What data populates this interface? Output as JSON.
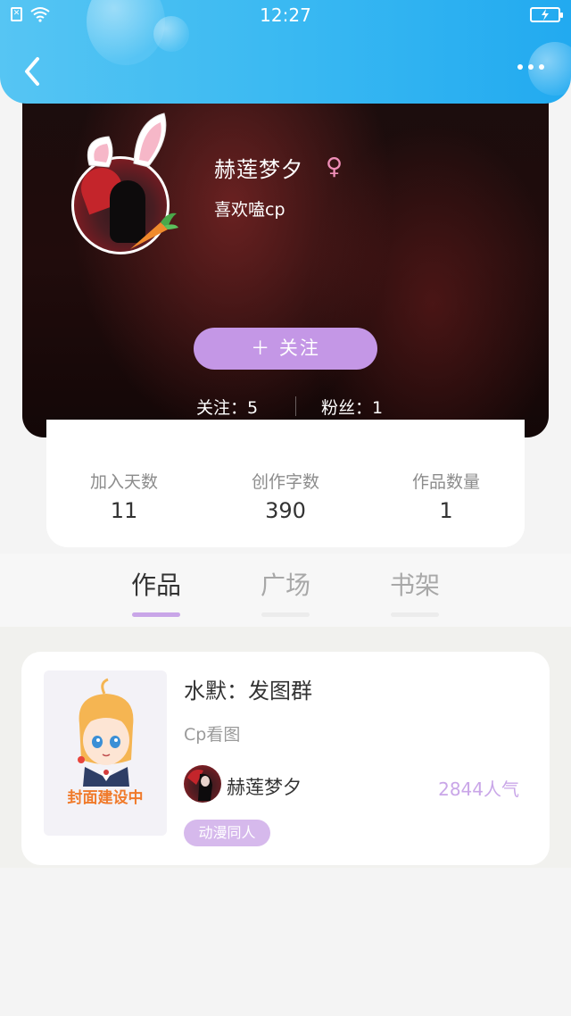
{
  "status_bar": {
    "time": "12:27"
  },
  "profile": {
    "username": "赫莲梦夕",
    "gender_symbol": "♀",
    "signature": "喜欢嗑cp",
    "follow_button": "＋  关注",
    "following": "关注：5",
    "fans": "粉丝：1"
  },
  "stats": [
    {
      "label": "加入天数",
      "value": "11"
    },
    {
      "label": "创作字数",
      "value": "390"
    },
    {
      "label": "作品数量",
      "value": "1"
    }
  ],
  "tabs": [
    {
      "label": "作品",
      "active": true
    },
    {
      "label": "广场",
      "active": false
    },
    {
      "label": "书架",
      "active": false
    }
  ],
  "works": [
    {
      "cover_text": "封面建设中",
      "title": "水默：发图群",
      "description": "Cp看图",
      "author": "赫莲梦夕",
      "popularity": "2844人气",
      "tag": "动漫同人"
    }
  ],
  "colors": {
    "header": "#3ab9f2",
    "accent_purple": "#c497e6",
    "tag_purple": "#d6b9ec",
    "female_pink": "#f08fb8",
    "cover_orange": "#f07a2a"
  }
}
